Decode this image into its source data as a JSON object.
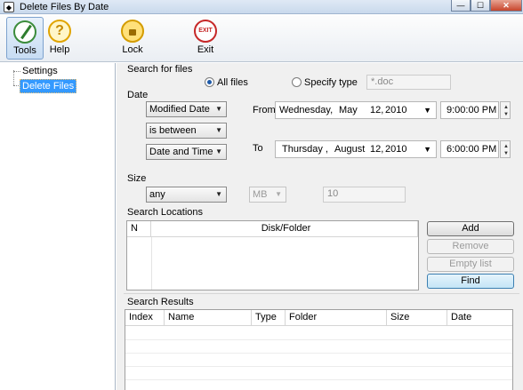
{
  "window": {
    "title": "Delete Files By Date",
    "app_icon": "app-icon",
    "controls": {
      "minimize": "—",
      "maximize": "☐",
      "close": "✕"
    }
  },
  "toolbar": {
    "items": [
      {
        "label": "Tools",
        "icon": "tools-icon",
        "active": true
      },
      {
        "label": "Help",
        "icon": "help-icon",
        "glyph": "?"
      },
      {
        "label": "Lock",
        "icon": "lock-icon"
      },
      {
        "label": "Exit",
        "icon": "exit-icon",
        "glyph": "EXIT"
      }
    ]
  },
  "sidebar": {
    "items": [
      {
        "label": "Settings",
        "selected": false
      },
      {
        "label": "Delete Files",
        "selected": true
      }
    ]
  },
  "search_for_files": {
    "heading": "Search for files",
    "all_files_label": "All files",
    "specify_type_label": "Specify type",
    "selected": "All files",
    "type_placeholder": "*.doc"
  },
  "date": {
    "heading": "Date",
    "field_select": "Modified Date",
    "condition_select": "is between",
    "mode_select": "Date and Time",
    "from_label": "From",
    "to_label": "To",
    "from": {
      "weekday": "Wednesday,",
      "month": "May",
      "day": "12,",
      "year": "2010",
      "time": "9:00:00 PM"
    },
    "to": {
      "weekday": "Thursday ,",
      "month": "August",
      "day": "12,",
      "year": "2010",
      "time": "6:00:00 PM"
    }
  },
  "size": {
    "heading": "Size",
    "condition_select": "any",
    "unit_select": "MB",
    "value": "10"
  },
  "search_locations": {
    "heading": "Search Locations",
    "columns": [
      "N",
      "Disk/Folder"
    ],
    "rows": [],
    "buttons": {
      "add": "Add",
      "remove": "Remove",
      "empty": "Empty list",
      "find": "Find"
    }
  },
  "search_results": {
    "heading": "Search Results",
    "columns": [
      "Index",
      "Name",
      "Type",
      "Folder",
      "Size",
      "Date"
    ],
    "rows": []
  },
  "glyphs": {
    "dropdown": "▼",
    "spin_up": "▲",
    "spin_down": "▼",
    "tree_toggle": ""
  }
}
